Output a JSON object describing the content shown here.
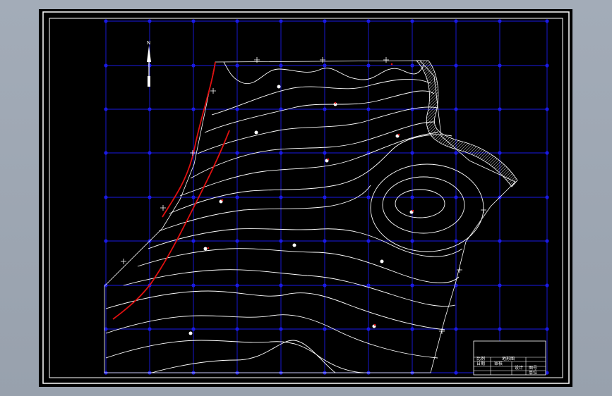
{
  "drawing": {
    "north_arrow_label": "N",
    "title_block": {
      "title": "地形图",
      "cells": [
        "比例",
        "日期",
        "审核",
        "设计",
        "图号",
        "单位"
      ]
    }
  },
  "colors": {
    "grid": "#1a1ae6",
    "contour": "#ffffff",
    "road": "#e01010",
    "frame": "#ffffff",
    "background": "#000000",
    "hatch": "#ffffff"
  }
}
